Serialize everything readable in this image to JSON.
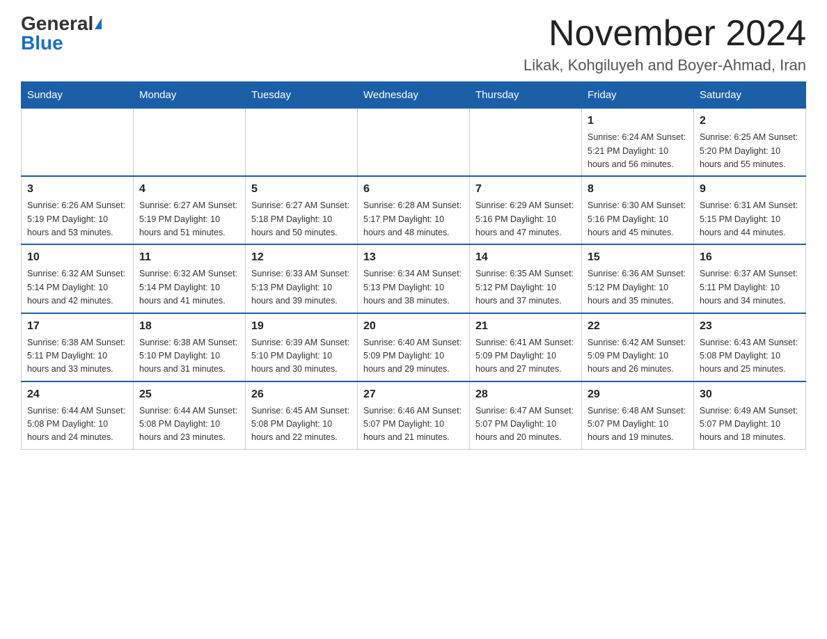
{
  "header": {
    "logo_general": "General",
    "logo_blue": "Blue",
    "month": "November 2024",
    "location": "Likak, Kohgiluyeh and Boyer-Ahmad, Iran"
  },
  "days_of_week": [
    "Sunday",
    "Monday",
    "Tuesday",
    "Wednesday",
    "Thursday",
    "Friday",
    "Saturday"
  ],
  "weeks": [
    [
      {
        "day": "",
        "info": ""
      },
      {
        "day": "",
        "info": ""
      },
      {
        "day": "",
        "info": ""
      },
      {
        "day": "",
        "info": ""
      },
      {
        "day": "",
        "info": ""
      },
      {
        "day": "1",
        "info": "Sunrise: 6:24 AM\nSunset: 5:21 PM\nDaylight: 10 hours\nand 56 minutes."
      },
      {
        "day": "2",
        "info": "Sunrise: 6:25 AM\nSunset: 5:20 PM\nDaylight: 10 hours\nand 55 minutes."
      }
    ],
    [
      {
        "day": "3",
        "info": "Sunrise: 6:26 AM\nSunset: 5:19 PM\nDaylight: 10 hours\nand 53 minutes."
      },
      {
        "day": "4",
        "info": "Sunrise: 6:27 AM\nSunset: 5:19 PM\nDaylight: 10 hours\nand 51 minutes."
      },
      {
        "day": "5",
        "info": "Sunrise: 6:27 AM\nSunset: 5:18 PM\nDaylight: 10 hours\nand 50 minutes."
      },
      {
        "day": "6",
        "info": "Sunrise: 6:28 AM\nSunset: 5:17 PM\nDaylight: 10 hours\nand 48 minutes."
      },
      {
        "day": "7",
        "info": "Sunrise: 6:29 AM\nSunset: 5:16 PM\nDaylight: 10 hours\nand 47 minutes."
      },
      {
        "day": "8",
        "info": "Sunrise: 6:30 AM\nSunset: 5:16 PM\nDaylight: 10 hours\nand 45 minutes."
      },
      {
        "day": "9",
        "info": "Sunrise: 6:31 AM\nSunset: 5:15 PM\nDaylight: 10 hours\nand 44 minutes."
      }
    ],
    [
      {
        "day": "10",
        "info": "Sunrise: 6:32 AM\nSunset: 5:14 PM\nDaylight: 10 hours\nand 42 minutes."
      },
      {
        "day": "11",
        "info": "Sunrise: 6:32 AM\nSunset: 5:14 PM\nDaylight: 10 hours\nand 41 minutes."
      },
      {
        "day": "12",
        "info": "Sunrise: 6:33 AM\nSunset: 5:13 PM\nDaylight: 10 hours\nand 39 minutes."
      },
      {
        "day": "13",
        "info": "Sunrise: 6:34 AM\nSunset: 5:13 PM\nDaylight: 10 hours\nand 38 minutes."
      },
      {
        "day": "14",
        "info": "Sunrise: 6:35 AM\nSunset: 5:12 PM\nDaylight: 10 hours\nand 37 minutes."
      },
      {
        "day": "15",
        "info": "Sunrise: 6:36 AM\nSunset: 5:12 PM\nDaylight: 10 hours\nand 35 minutes."
      },
      {
        "day": "16",
        "info": "Sunrise: 6:37 AM\nSunset: 5:11 PM\nDaylight: 10 hours\nand 34 minutes."
      }
    ],
    [
      {
        "day": "17",
        "info": "Sunrise: 6:38 AM\nSunset: 5:11 PM\nDaylight: 10 hours\nand 33 minutes."
      },
      {
        "day": "18",
        "info": "Sunrise: 6:38 AM\nSunset: 5:10 PM\nDaylight: 10 hours\nand 31 minutes."
      },
      {
        "day": "19",
        "info": "Sunrise: 6:39 AM\nSunset: 5:10 PM\nDaylight: 10 hours\nand 30 minutes."
      },
      {
        "day": "20",
        "info": "Sunrise: 6:40 AM\nSunset: 5:09 PM\nDaylight: 10 hours\nand 29 minutes."
      },
      {
        "day": "21",
        "info": "Sunrise: 6:41 AM\nSunset: 5:09 PM\nDaylight: 10 hours\nand 27 minutes."
      },
      {
        "day": "22",
        "info": "Sunrise: 6:42 AM\nSunset: 5:09 PM\nDaylight: 10 hours\nand 26 minutes."
      },
      {
        "day": "23",
        "info": "Sunrise: 6:43 AM\nSunset: 5:08 PM\nDaylight: 10 hours\nand 25 minutes."
      }
    ],
    [
      {
        "day": "24",
        "info": "Sunrise: 6:44 AM\nSunset: 5:08 PM\nDaylight: 10 hours\nand 24 minutes."
      },
      {
        "day": "25",
        "info": "Sunrise: 6:44 AM\nSunset: 5:08 PM\nDaylight: 10 hours\nand 23 minutes."
      },
      {
        "day": "26",
        "info": "Sunrise: 6:45 AM\nSunset: 5:08 PM\nDaylight: 10 hours\nand 22 minutes."
      },
      {
        "day": "27",
        "info": "Sunrise: 6:46 AM\nSunset: 5:07 PM\nDaylight: 10 hours\nand 21 minutes."
      },
      {
        "day": "28",
        "info": "Sunrise: 6:47 AM\nSunset: 5:07 PM\nDaylight: 10 hours\nand 20 minutes."
      },
      {
        "day": "29",
        "info": "Sunrise: 6:48 AM\nSunset: 5:07 PM\nDaylight: 10 hours\nand 19 minutes."
      },
      {
        "day": "30",
        "info": "Sunrise: 6:49 AM\nSunset: 5:07 PM\nDaylight: 10 hours\nand 18 minutes."
      }
    ]
  ]
}
